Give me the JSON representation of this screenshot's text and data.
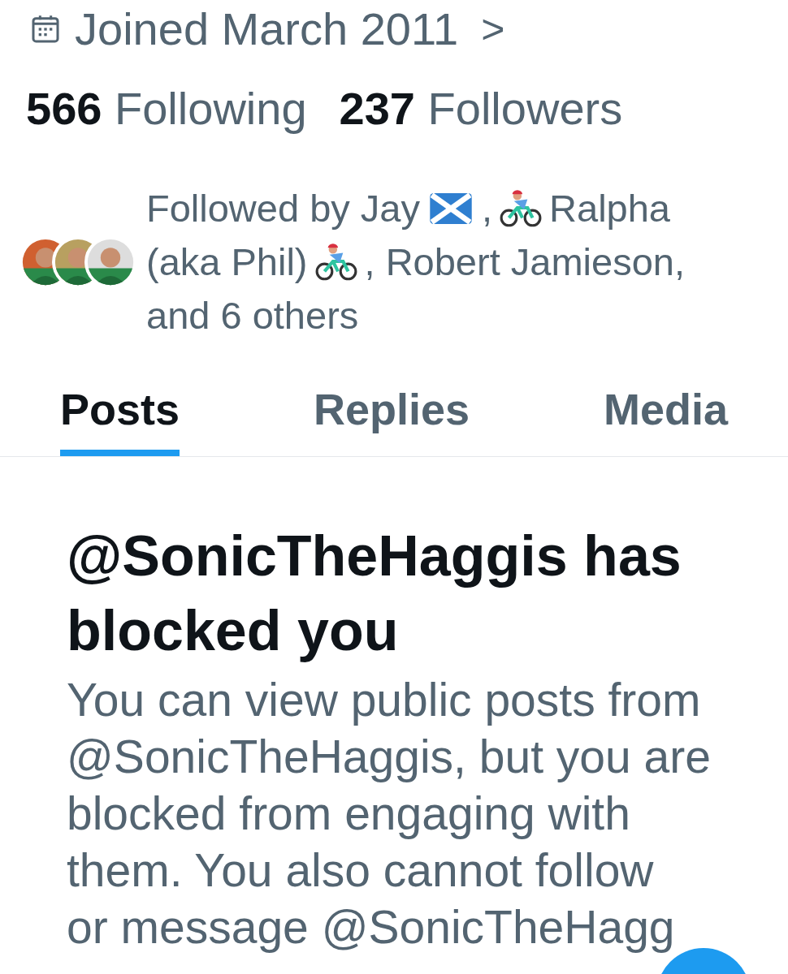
{
  "joined": {
    "text": "Joined March 2011",
    "chevron": ">"
  },
  "stats": [
    {
      "count": "566",
      "label": "Following"
    },
    {
      "count": "237",
      "label": "Followers"
    }
  ],
  "followed_by": {
    "avatars": [
      {
        "kind": "picture"
      },
      {
        "kind": "picture"
      },
      {
        "kind": "picture"
      }
    ],
    "lines": [
      [
        {
          "kind": "text",
          "text": "Followed by Jay"
        },
        {
          "kind": "flag"
        },
        {
          "kind": "text",
          "text": ","
        },
        {
          "kind": "cyclist"
        },
        {
          "kind": "text",
          "text": "Ralpha"
        }
      ],
      [
        {
          "kind": "text",
          "text": "(aka Phil)"
        },
        {
          "kind": "cyclist"
        },
        {
          "kind": "text",
          "text": ", Robert Jamieson,"
        }
      ],
      [
        {
          "kind": "text",
          "text": "and 6 others"
        }
      ]
    ]
  },
  "tabs": [
    {
      "label": "Posts",
      "selected": true
    },
    {
      "label": "Replies",
      "selected": false
    },
    {
      "label": "Media",
      "selected": false
    }
  ],
  "notice": {
    "title": "@SonicTheHaggis has blocked you",
    "lines": [
      "You can view public posts from",
      "@SonicTheHaggis, but you are",
      "blocked from engaging with",
      "them. You also cannot follow",
      "or message @SonicTheHagg"
    ]
  }
}
